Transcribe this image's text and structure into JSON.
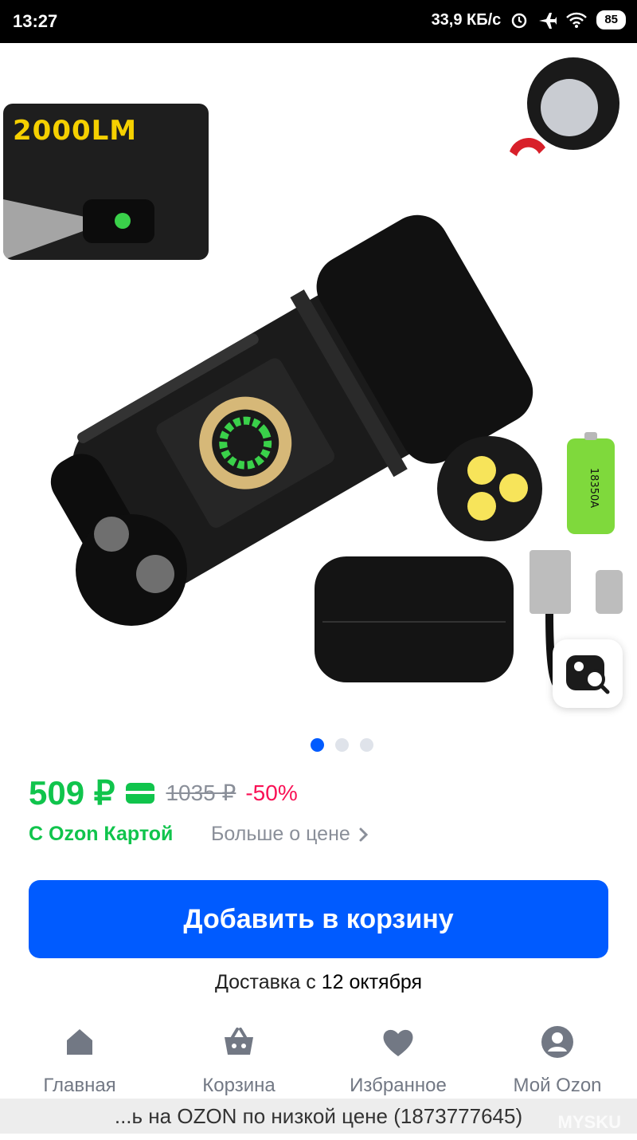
{
  "status_bar": {
    "time": "13:27",
    "network_speed": "33,9 КБ/с",
    "battery": "85"
  },
  "product": {
    "thumbnail_label": "2000LM",
    "battery_label": "18350A",
    "gallery_dots": 3,
    "gallery_active": 0
  },
  "price": {
    "current": "509 ₽",
    "old": "1035 ₽",
    "discount": "-50%",
    "ozon_card_label": "С Ozon Картой",
    "more_label": "Больше о цене"
  },
  "cart_button": {
    "label": "Добавить в корзину"
  },
  "delivery": {
    "prefix": "Доставка с",
    "date": "12 октября"
  },
  "nav": {
    "items": [
      {
        "label": "Главная",
        "icon": "home-icon"
      },
      {
        "label": "Корзина",
        "icon": "basket-icon"
      },
      {
        "label": "Избранное",
        "icon": "heart-icon"
      },
      {
        "label": "Мой Ozon",
        "icon": "profile-icon"
      }
    ]
  },
  "bottom_strip": {
    "text": "...ь на OZON по низкой цене (1873777645)",
    "watermark": "MYSKU"
  },
  "colors": {
    "accent": "#005bff",
    "price_green": "#10c44c",
    "discount_pink": "#f91155"
  }
}
